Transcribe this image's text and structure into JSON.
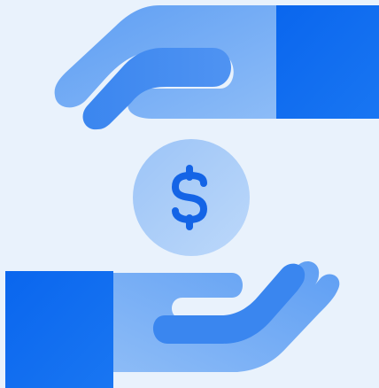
{
  "illustration": {
    "subject": "hands-exchanging-coin",
    "coin_symbol": "$",
    "icons": {
      "top_hand": "hand-giving-icon",
      "bottom_hand": "hand-receiving-icon",
      "coin": "dollar-coin-icon"
    },
    "colors": {
      "background": "#e9f2fc",
      "sleeve": "#0c6cf0",
      "hand_light": "#7ab0f6",
      "hand_mid": "#5c9cf2",
      "finger_dark": "#3a86ef",
      "coin_fill": "#a9cbf8",
      "symbol": "#1464e6"
    }
  }
}
